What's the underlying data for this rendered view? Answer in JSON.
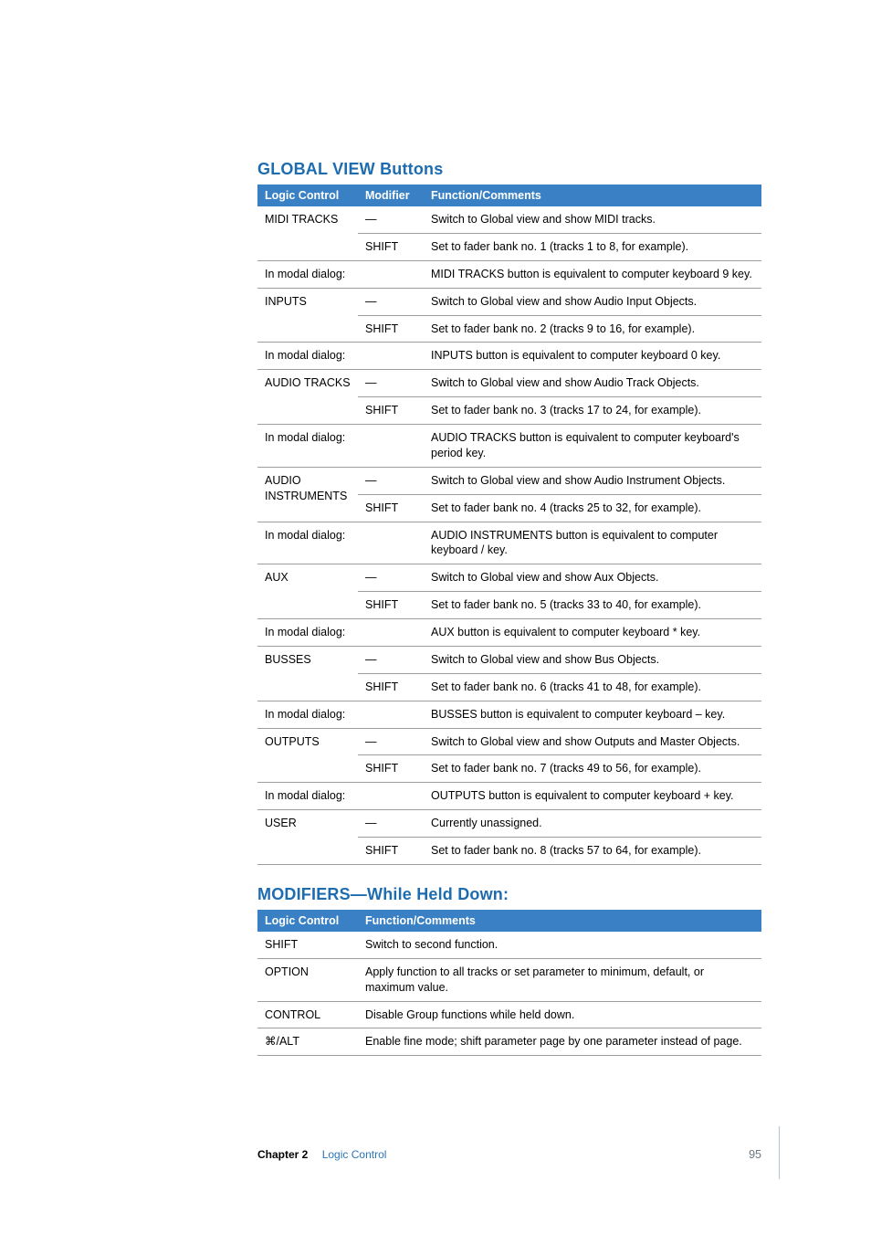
{
  "sections": {
    "global_view": {
      "title": "GLOBAL VIEW Buttons",
      "headers": {
        "lc": "Logic Control",
        "mod": "Modifier",
        "fc": "Function/Comments"
      },
      "rows": [
        {
          "lc": "MIDI TRACKS",
          "mod": "—",
          "fc": "Switch to Global view and show MIDI tracks."
        },
        {
          "lc": "",
          "mod": "SHIFT",
          "fc": "Set to fader bank no. 1 (tracks 1 to 8, for example)."
        },
        {
          "lc": "In modal dialog:",
          "mod": "",
          "fc": "MIDI TRACKS button is equivalent to computer keyboard 9 key."
        },
        {
          "lc": "INPUTS",
          "mod": "—",
          "fc": "Switch to Global view and show Audio Input Objects."
        },
        {
          "lc": "",
          "mod": "SHIFT",
          "fc": "Set to fader bank no. 2 (tracks 9 to 16, for example)."
        },
        {
          "lc": "In modal dialog:",
          "mod": "",
          "fc": "INPUTS button is equivalent to computer keyboard 0 key."
        },
        {
          "lc": "AUDIO TRACKS",
          "mod": "—",
          "fc": "Switch to Global view and show Audio Track Objects."
        },
        {
          "lc": "",
          "mod": "SHIFT",
          "fc": "Set to fader bank no. 3 (tracks 17 to 24, for example)."
        },
        {
          "lc": "In modal dialog:",
          "mod": "",
          "fc": "AUDIO TRACKS button is equivalent to computer keyboard's period key."
        },
        {
          "lc": "AUDIO",
          "lc2": "INSTRUMENTS",
          "mod": "—",
          "fc": "Switch to Global view and show Audio Instrument Objects."
        },
        {
          "lc": "",
          "mod": "SHIFT",
          "fc": "Set to fader bank no. 4 (tracks 25 to 32, for example)."
        },
        {
          "lc": "In modal dialog:",
          "mod": "",
          "fc": "AUDIO INSTRUMENTS button is equivalent to computer keyboard / key."
        },
        {
          "lc": "AUX",
          "mod": "—",
          "fc": "Switch to Global view and show Aux Objects."
        },
        {
          "lc": "",
          "mod": "SHIFT",
          "fc": "Set to fader bank no. 5 (tracks 33 to 40, for example)."
        },
        {
          "lc": "In modal dialog:",
          "mod": "",
          "fc": "AUX button is equivalent to computer keyboard * key."
        },
        {
          "lc": "BUSSES",
          "mod": "—",
          "fc": "Switch to Global view and show Bus Objects."
        },
        {
          "lc": "",
          "mod": "SHIFT",
          "fc": "Set to fader bank no. 6 (tracks 41 to 48, for example)."
        },
        {
          "lc": "In modal dialog:",
          "mod": "",
          "fc": "BUSSES button is equivalent to computer keyboard – key."
        },
        {
          "lc": "OUTPUTS",
          "mod": "—",
          "fc": "Switch to Global view and show Outputs and Master Objects."
        },
        {
          "lc": "",
          "mod": "SHIFT",
          "fc": "Set to fader bank no. 7 (tracks 49 to 56, for example)."
        },
        {
          "lc": "In modal dialog:",
          "mod": "",
          "fc": "OUTPUTS button is equivalent to computer keyboard + key."
        },
        {
          "lc": "USER",
          "mod": "—",
          "fc": "Currently unassigned."
        },
        {
          "lc": "",
          "mod": "SHIFT",
          "fc": "Set to fader bank no. 8 (tracks 57 to 64, for example)."
        }
      ]
    },
    "modifiers": {
      "title": "MODIFIERS—While Held Down:",
      "headers": {
        "lc": "Logic Control",
        "fc": "Function/Comments"
      },
      "rows": [
        {
          "lc": "SHIFT",
          "fc": "Switch to second function."
        },
        {
          "lc": "OPTION",
          "fc": "Apply function to all tracks or set parameter to minimum, default, or maximum value."
        },
        {
          "lc": "CONTROL",
          "fc": "Disable Group functions while held down."
        },
        {
          "lc": "⌘/ALT",
          "fc": "Enable fine mode; shift parameter page by one parameter instead of page."
        }
      ]
    }
  },
  "footer": {
    "chapter_label": "Chapter 2",
    "chapter_title": "Logic Control",
    "page": "95"
  }
}
